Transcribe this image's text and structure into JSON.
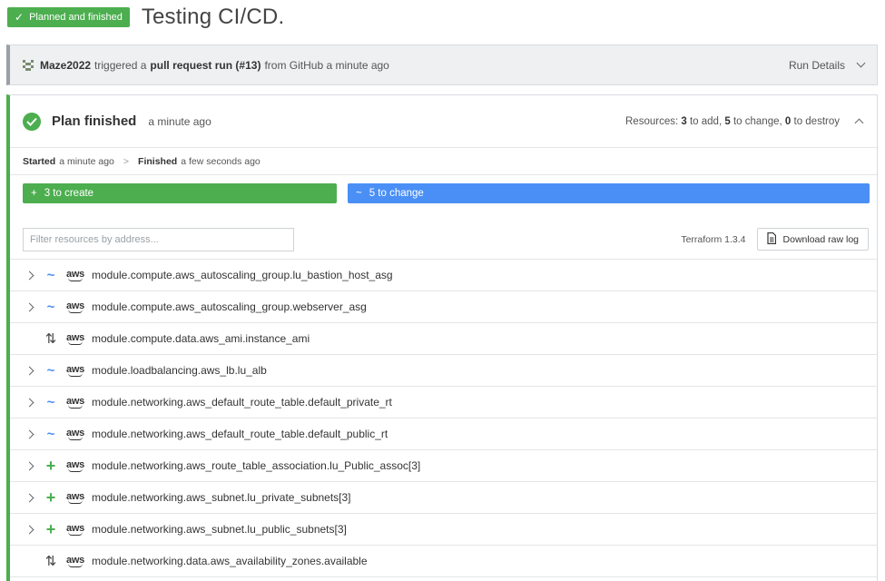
{
  "header": {
    "status_label": "Planned and finished",
    "title": "Testing CI/CD."
  },
  "trigger": {
    "user": "Maze2022",
    "text_triggered": "triggered a",
    "run_type": "pull request run (#13)",
    "text_from": "from GitHub a minute ago",
    "details_label": "Run Details"
  },
  "plan": {
    "title": "Plan finished",
    "time": "a minute ago",
    "resources_prefix": "Resources:",
    "add_count": "3",
    "add_label": "to add,",
    "change_count": "5",
    "change_label": "to change,",
    "destroy_count": "0",
    "destroy_label": "to destroy",
    "started_label": "Started",
    "started_time": "a minute ago",
    "finished_label": "Finished",
    "finished_time": "a few seconds ago",
    "create_bar": "3 to create",
    "change_bar": "5 to change",
    "filter_placeholder": "Filter resources by address...",
    "terraform_version": "Terraform 1.3.4",
    "download_label": "Download raw log",
    "aws_label": "aws"
  },
  "resources": [
    {
      "action": "change",
      "expandable": true,
      "address": "module.compute.aws_autoscaling_group.lu_bastion_host_asg"
    },
    {
      "action": "change",
      "expandable": true,
      "address": "module.compute.aws_autoscaling_group.webserver_asg"
    },
    {
      "action": "read",
      "expandable": false,
      "address": "module.compute.data.aws_ami.instance_ami"
    },
    {
      "action": "change",
      "expandable": true,
      "address": "module.loadbalancing.aws_lb.lu_alb"
    },
    {
      "action": "change",
      "expandable": true,
      "address": "module.networking.aws_default_route_table.default_private_rt"
    },
    {
      "action": "change",
      "expandable": true,
      "address": "module.networking.aws_default_route_table.default_public_rt"
    },
    {
      "action": "create",
      "expandable": true,
      "address": "module.networking.aws_route_table_association.lu_Public_assoc[3]"
    },
    {
      "action": "create",
      "expandable": true,
      "address": "module.networking.aws_subnet.lu_private_subnets[3]"
    },
    {
      "action": "create",
      "expandable": true,
      "address": "module.networking.aws_subnet.lu_public_subnets[3]"
    },
    {
      "action": "read",
      "expandable": false,
      "address": "module.networking.data.aws_availability_zones.available"
    }
  ],
  "colors": {
    "success": "#4cae4f",
    "change": "#4a8ff5"
  }
}
